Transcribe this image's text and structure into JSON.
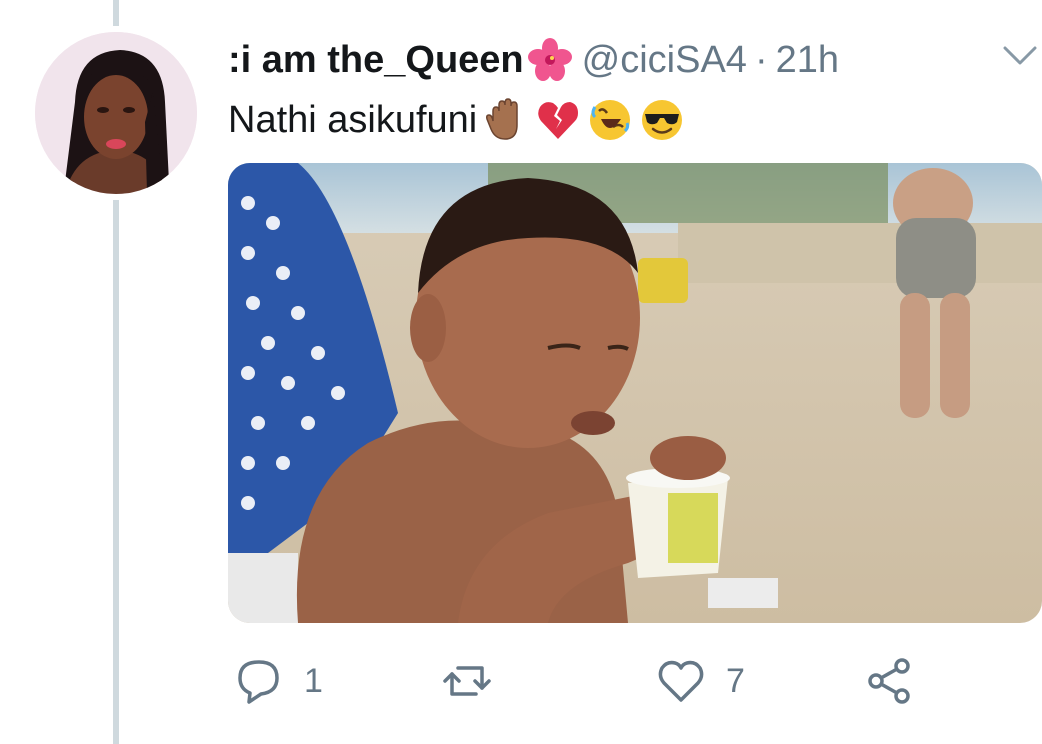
{
  "tweet": {
    "display_name": ":i am the_Queen",
    "handle": "@ciciSA4",
    "separator": "·",
    "time": "21h",
    "text": "Nathi asikufuni",
    "text_emojis": [
      "raised-back-of-hand-medium-dark-skin",
      "broken-heart",
      "rolling-on-the-floor-laughing",
      "smiling-face-with-sunglasses"
    ],
    "name_emoji": "hibiscus"
  },
  "actions": {
    "reply_count": "1",
    "retweet_count": "",
    "like_count": "7"
  },
  "icons": {
    "reply": "reply-icon",
    "retweet": "retweet-icon",
    "like": "like-icon",
    "share": "share-icon",
    "more": "chevron-down-icon"
  },
  "colors": {
    "text": "#14171a",
    "secondary": "#657786",
    "thread_line": "#cfd9de"
  }
}
